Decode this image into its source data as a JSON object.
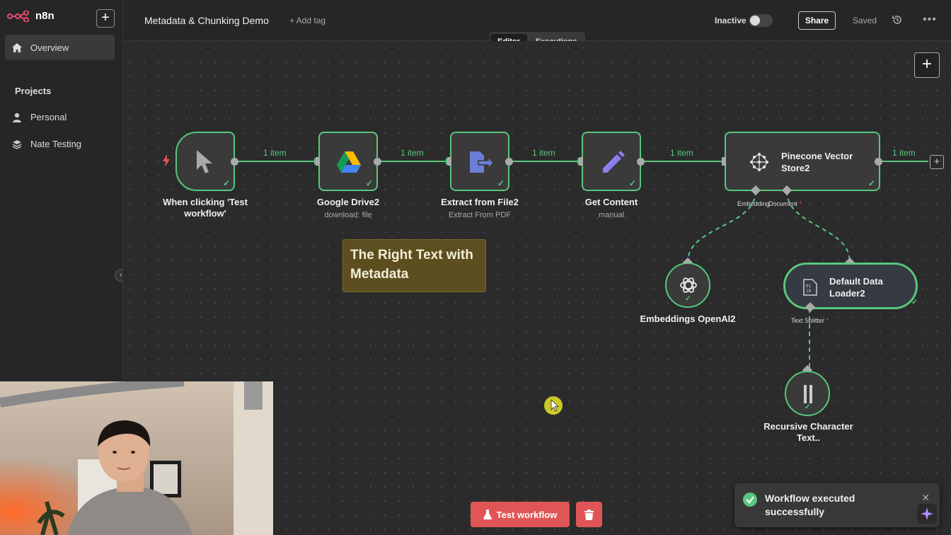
{
  "sidebar": {
    "logo": "n8n",
    "overview": "Overview",
    "projects_heading": "Projects",
    "items": [
      {
        "label": "Personal"
      },
      {
        "label": "Nate Testing"
      }
    ]
  },
  "header": {
    "title": "Metadata & Chunking Demo",
    "add_tag": "+ Add tag",
    "status": "Inactive",
    "share": "Share",
    "saved": "Saved",
    "tabs": [
      {
        "label": "Editor"
      },
      {
        "label": "Executions"
      }
    ]
  },
  "nodes": [
    {
      "title": "When clicking 'Test workflow'",
      "sub": ""
    },
    {
      "title": "Google Drive2",
      "sub": "download: file"
    },
    {
      "title": "Extract from File2",
      "sub": "Extract From PDF"
    },
    {
      "title": "Get Content",
      "sub": "manual"
    },
    {
      "title": "Pinecone Vector Store2",
      "sub": ""
    },
    {
      "title": "Embeddings OpenAI2",
      "sub": ""
    },
    {
      "title": "Default Data Loader2",
      "sub": ""
    },
    {
      "title": "Recursive Character Text..",
      "sub": ""
    }
  ],
  "connections": {
    "item_label": "1 item"
  },
  "sub_inputs": {
    "embedding": "Embedding",
    "document": "Document",
    "text_splitter": "Text Splitter",
    "required_mark": "*"
  },
  "sticky_note": "The Right Text with Metadata",
  "footer": {
    "test_workflow": "Test workflow"
  },
  "toast": {
    "message": "Workflow executed successfully"
  },
  "colors": {
    "success": "#58c77d",
    "danger": "#e05555",
    "canvas": "#2b2b2b",
    "sticky": "#5c4e1f"
  }
}
